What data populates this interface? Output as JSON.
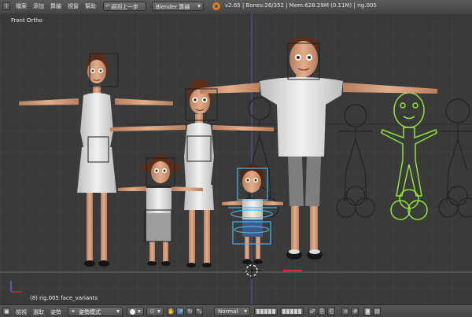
{
  "menu": {
    "file": "檔案",
    "add": "添加",
    "render": "算繪",
    "view": "視窗",
    "help": "幫助"
  },
  "header": {
    "back_button": "返回上一步",
    "engine": "Blender 算繪",
    "info": "v2.65 | Bones:26/352 | Mem:628.29M (0.11M) | rig.005"
  },
  "viewport": {
    "view_label": "Front Ortho",
    "status": "(8) rig.005 face_variants"
  },
  "footer": {
    "view_menu": "檢視",
    "select_menu": "選取",
    "pose_menu": "姿勢",
    "mode": "姿勢模式",
    "orientation": "Normal"
  },
  "colors": {
    "selected_rig": "#8fe33b",
    "rig_wire": "#1e1e1e",
    "active_bone": "#4fb3e6",
    "grid": "#444444"
  }
}
